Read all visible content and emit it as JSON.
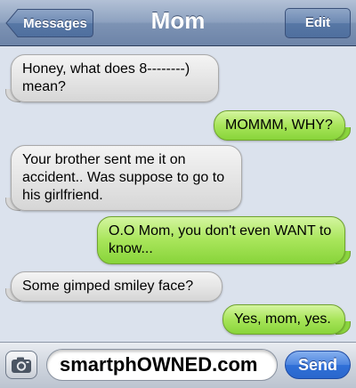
{
  "navbar": {
    "back_label": "Messages",
    "title": "Mom",
    "edit_label": "Edit"
  },
  "messages": [
    {
      "direction": "incoming",
      "text": "Honey, what does 8--------) mean?"
    },
    {
      "direction": "outgoing",
      "text": "MOMMM, WHY?"
    },
    {
      "direction": "incoming",
      "text": "Your brother sent me it on accident.. Was suppose to go to his girlfriend."
    },
    {
      "direction": "outgoing",
      "text": "O.O Mom, you don't even WANT to know..."
    },
    {
      "direction": "incoming",
      "text": "Some gimped smiley face?"
    },
    {
      "direction": "outgoing",
      "text": "Yes, mom, yes."
    }
  ],
  "input_bar": {
    "camera_icon": "camera-icon",
    "field_value": "smartphOWNED.com",
    "send_label": "Send"
  },
  "colors": {
    "incoming_bubble": "#e4e4e4",
    "outgoing_bubble": "#a8e55a",
    "navbar": "#8ea2c0",
    "send_button": "#3070d8",
    "background": "#dbe2ed"
  }
}
